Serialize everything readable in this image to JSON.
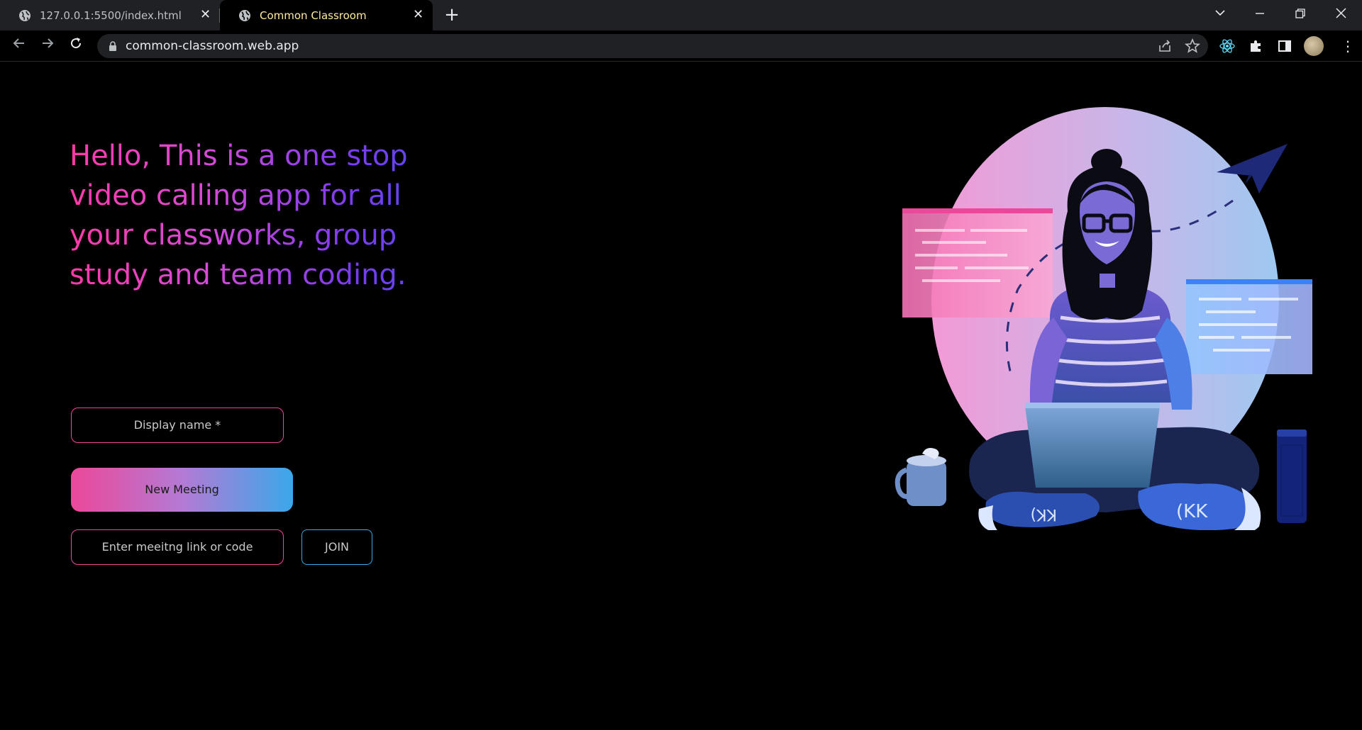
{
  "browser": {
    "tabs": [
      {
        "title": "127.0.0.1:5500/index.html",
        "active": false
      },
      {
        "title": "Common Classroom",
        "active": true
      }
    ],
    "url": "common-classroom.web.app",
    "icons": {
      "back": "back-arrow-icon",
      "forward": "forward-arrow-icon",
      "reload": "reload-icon",
      "share": "share-icon",
      "bookmark": "star-icon",
      "react_devtools": "react-icon",
      "extensions": "puzzle-icon",
      "side_panel": "side-panel-icon",
      "menu": "kebab-menu-icon"
    }
  },
  "hero": {
    "text": "Hello, This is a one stop video calling app for all your classworks, group study and team coding."
  },
  "form": {
    "display_name_placeholder": "Display name *",
    "new_meeting_label": "New Meeting",
    "link_placeholder": "Enter meeitng link or code",
    "join_label": "JOIN"
  },
  "illustration": {
    "sneaker_text": "(KK",
    "colors": {
      "pink": "#ec4899",
      "blue": "#3aa8ea",
      "purple": "#7c3cf0"
    }
  }
}
